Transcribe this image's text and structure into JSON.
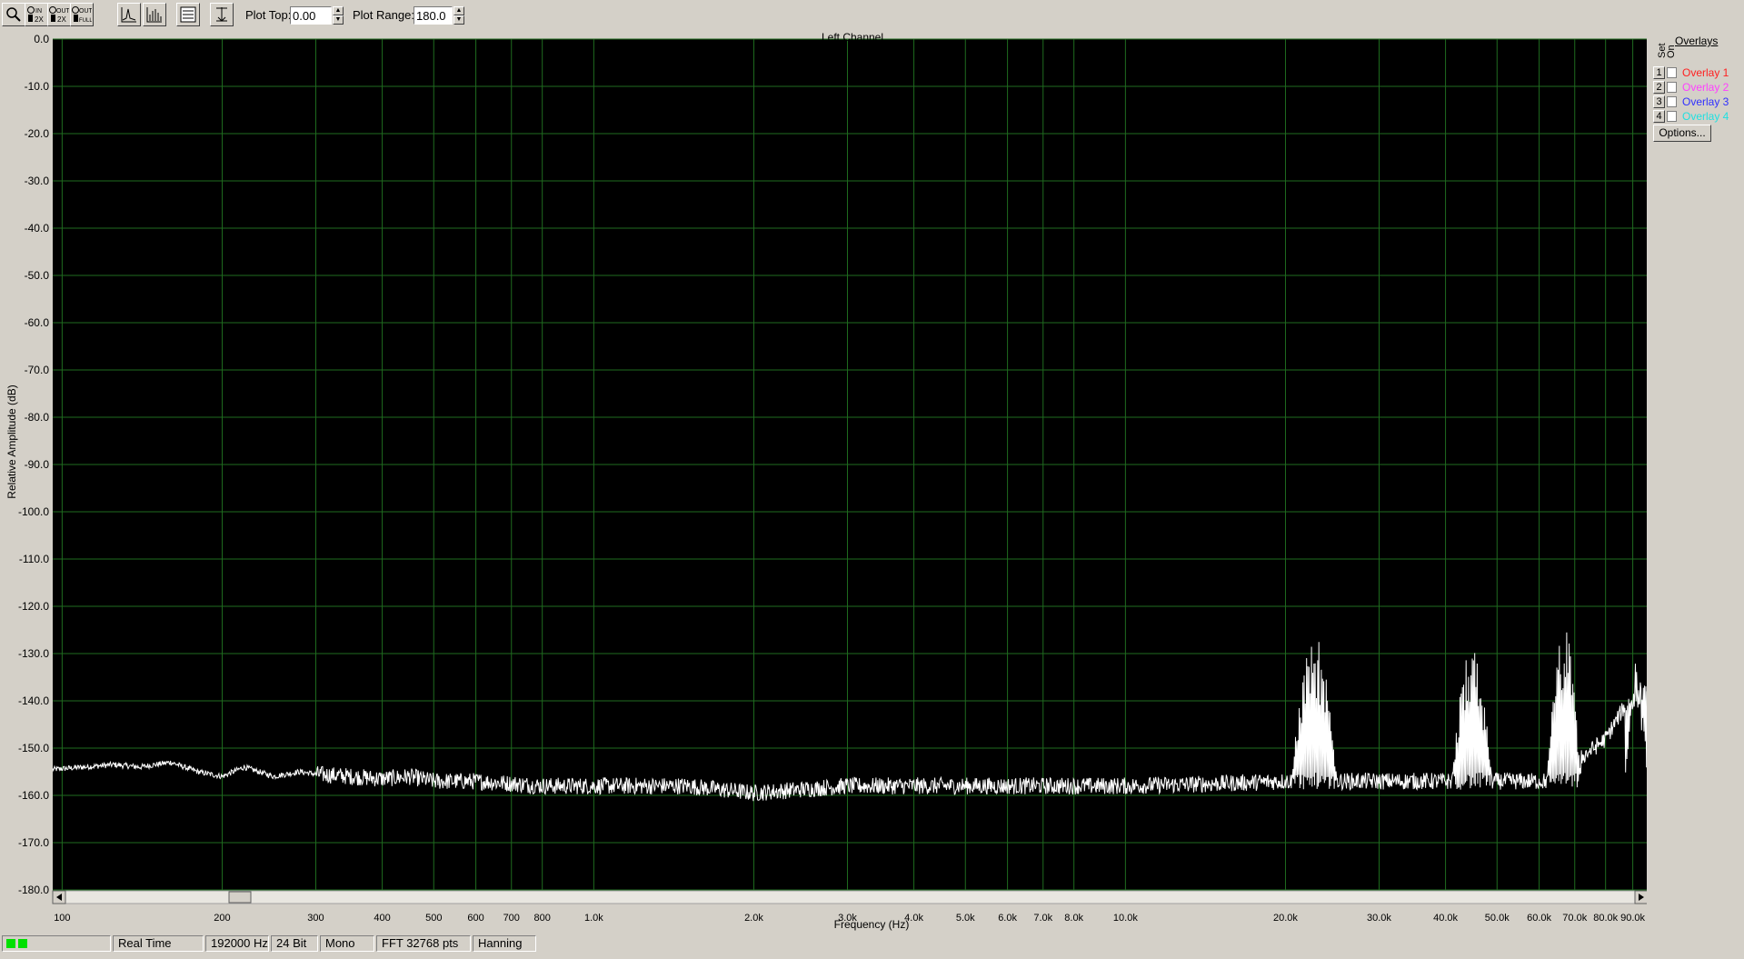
{
  "toolbar": {
    "buttons": [
      {
        "name": "zoom-icon",
        "label": ""
      },
      {
        "name": "zoom-in-2x-icon",
        "label": "IN 2X"
      },
      {
        "name": "zoom-out-2x-icon",
        "label": "OUT 2X"
      },
      {
        "name": "zoom-out-full-icon",
        "label": "OUT FULL"
      },
      {
        "name": "line-graph-icon",
        "label": ""
      },
      {
        "name": "bar-graph-icon",
        "label": ""
      },
      {
        "name": "settings-table-icon",
        "label": ""
      },
      {
        "name": "cursor-icon",
        "label": ""
      }
    ],
    "plot_top_label": "Plot Top:",
    "plot_top_value": "0.00",
    "plot_range_label": "Plot Range:",
    "plot_range_value": "180.0"
  },
  "overlays": {
    "title": "Overlays",
    "set_label": "Set",
    "on_label": "On",
    "items": [
      {
        "num": "1",
        "label": "Overlay 1",
        "color": "#ff2020"
      },
      {
        "num": "2",
        "label": "Overlay 2",
        "color": "#ff40ff"
      },
      {
        "num": "3",
        "label": "Overlay 3",
        "color": "#3030ff"
      },
      {
        "num": "4",
        "label": "Overlay 4",
        "color": "#20e0e0"
      }
    ],
    "options_label": "Options..."
  },
  "status": {
    "mode": "Real Time",
    "sample_rate": "192000 Hz",
    "bit_depth": "24 Bit",
    "channels": "Mono",
    "fft": "FFT 32768 pts",
    "window": "Hanning"
  },
  "chart_data": {
    "type": "line",
    "title": "Left Channel",
    "xlabel": "Frequency (Hz)",
    "ylabel": "Relative Amplitude (dB)",
    "xscale": "log",
    "xlim": [
      96,
      96000
    ],
    "ylim": [
      -180,
      0
    ],
    "grid": true,
    "colors": {
      "background": "#000000",
      "grid": "#1f6b1f",
      "trace": "#ffffff"
    },
    "y_ticks": [
      "0.0",
      "-10.0",
      "-20.0",
      "-30.0",
      "-40.0",
      "-50.0",
      "-60.0",
      "-70.0",
      "-80.0",
      "-90.0",
      "-100.0",
      "-110.0",
      "-120.0",
      "-130.0",
      "-140.0",
      "-150.0",
      "-160.0",
      "-170.0",
      "-180.0"
    ],
    "x_ticks": [
      {
        "v": 100,
        "label": "100"
      },
      {
        "v": 200,
        "label": "200"
      },
      {
        "v": 300,
        "label": "300"
      },
      {
        "v": 400,
        "label": "400"
      },
      {
        "v": 500,
        "label": "500"
      },
      {
        "v": 600,
        "label": "600"
      },
      {
        "v": 700,
        "label": "700"
      },
      {
        "v": 800,
        "label": "800"
      },
      {
        "v": 1000,
        "label": "1.0k"
      },
      {
        "v": 2000,
        "label": "2.0k"
      },
      {
        "v": 3000,
        "label": "3.0k"
      },
      {
        "v": 4000,
        "label": "4.0k"
      },
      {
        "v": 5000,
        "label": "5.0k"
      },
      {
        "v": 6000,
        "label": "6.0k"
      },
      {
        "v": 7000,
        "label": "7.0k"
      },
      {
        "v": 8000,
        "label": "8.0k"
      },
      {
        "v": 10000,
        "label": "10.0k"
      },
      {
        "v": 20000,
        "label": "20.0k"
      },
      {
        "v": 30000,
        "label": "30.0k"
      },
      {
        "v": 40000,
        "label": "40.0k"
      },
      {
        "v": 50000,
        "label": "50.0k"
      },
      {
        "v": 60000,
        "label": "60.0k"
      },
      {
        "v": 70000,
        "label": "70.0k"
      },
      {
        "v": 80000,
        "label": "80.0k"
      },
      {
        "v": 90000,
        "label": "90.0k"
      }
    ],
    "series": [
      {
        "values_note_points": [
          [
            96,
            -154.5
          ],
          [
            110,
            -154
          ],
          [
            125,
            -153.5
          ],
          [
            140,
            -154
          ],
          [
            160,
            -153
          ],
          [
            180,
            -155
          ],
          [
            200,
            -156
          ],
          [
            220,
            -154
          ],
          [
            250,
            -156
          ],
          [
            280,
            -155
          ],
          [
            300,
            -155.5
          ],
          [
            350,
            -156
          ],
          [
            400,
            -156.5
          ],
          [
            450,
            -156
          ],
          [
            500,
            -157
          ],
          [
            600,
            -157
          ],
          [
            700,
            -157.5
          ],
          [
            800,
            -158
          ],
          [
            1000,
            -158
          ],
          [
            1500,
            -158
          ],
          [
            2000,
            -159.5
          ],
          [
            3000,
            -158
          ],
          [
            5000,
            -158
          ],
          [
            8000,
            -158
          ],
          [
            10000,
            -158
          ],
          [
            15000,
            -157.5
          ],
          [
            20000,
            -157
          ]
        ],
        "peaks": [
          {
            "from": 20500,
            "to": 25000,
            "top": -125
          },
          {
            "from": 41000,
            "to": 49000,
            "top": -128
          },
          {
            "from": 62000,
            "to": 72000,
            "top": -124
          },
          {
            "from": 87000,
            "to": 96000,
            "top": -131
          }
        ],
        "rise": [
          [
            72000,
            -152
          ],
          [
            80000,
            -148
          ],
          [
            87000,
            -141
          ],
          [
            96000,
            -138
          ]
        ]
      }
    ]
  }
}
